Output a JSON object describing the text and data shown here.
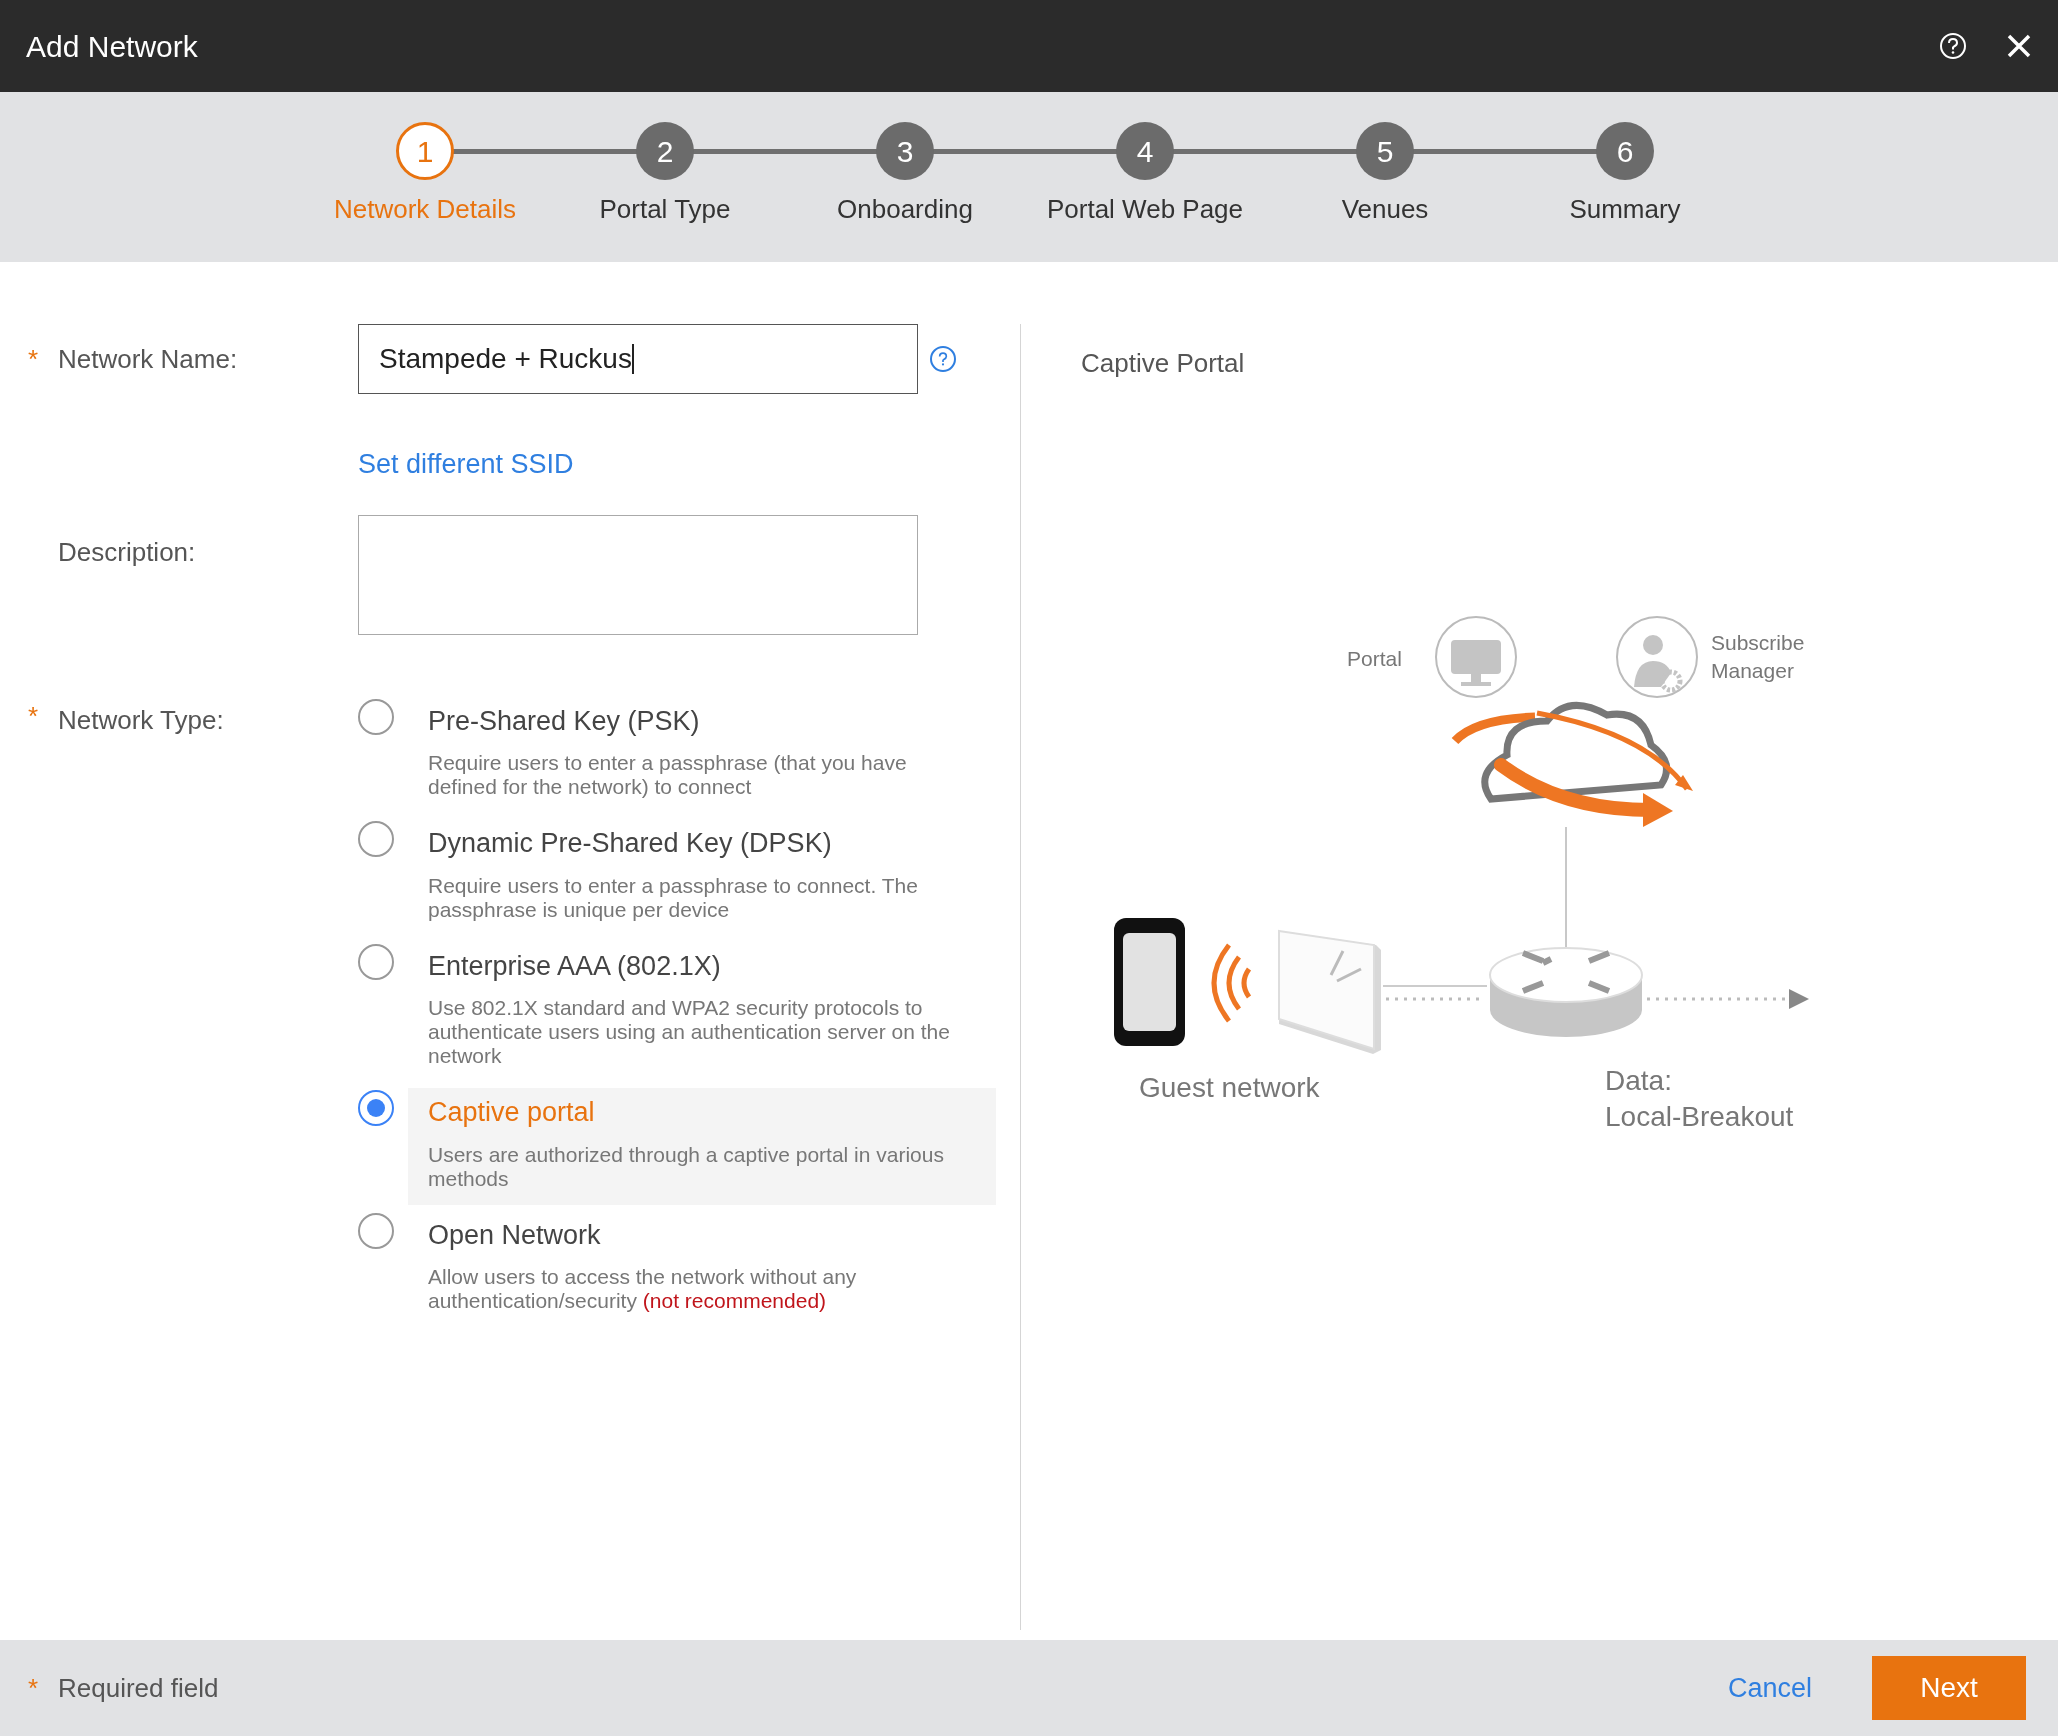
{
  "dialog": {
    "title": "Add Network"
  },
  "steps": [
    {
      "number": "1",
      "label": "Network Details",
      "selected": true
    },
    {
      "number": "2",
      "label": "Portal Type",
      "selected": false
    },
    {
      "number": "3",
      "label": "Onboarding",
      "selected": false
    },
    {
      "number": "4",
      "label": "Portal Web Page",
      "selected": false
    },
    {
      "number": "5",
      "label": "Venues",
      "selected": false
    },
    {
      "number": "6",
      "label": "Summary",
      "selected": false
    }
  ],
  "required_mark": "*",
  "form": {
    "network_name": {
      "label": "Network Name:",
      "required": true,
      "value": "Stampede + Ruckus"
    },
    "ssid_link": "Set different SSID",
    "description": {
      "label": "Description:",
      "required": false
    },
    "network_type": {
      "label": "Network Type:",
      "required": true,
      "options": [
        {
          "title": "Pre-Shared Key (PSK)",
          "description": "Require users to enter a passphrase (that you have defined for the network) to connect",
          "selected": false
        },
        {
          "title": "Dynamic Pre-Shared Key (DPSK)",
          "description": "Require users to enter a passphrase to connect. The passphrase is unique per device",
          "selected": false
        },
        {
          "title": "Enterprise AAA (802.1X)",
          "description": "Use 802.1X standard and WPA2 security protocols to authenticate users using an authentication server on the network",
          "selected": false
        },
        {
          "title": "Captive portal",
          "description": "Users are authorized through a captive portal in various methods",
          "selected": true
        },
        {
          "title": "Open Network",
          "description": "Allow users to access the network without any authentication/security",
          "warning": "(not recommended)",
          "selected": false
        }
      ]
    }
  },
  "preview": {
    "title": "Captive Portal",
    "portal_label": "Portal",
    "manager_label": [
      "Subscribe",
      "Manager"
    ],
    "guest_label": "Guest network",
    "data_label": [
      "Data:",
      "Local-Breakout"
    ]
  },
  "footer": {
    "required_note": "Required field",
    "cancel": "Cancel",
    "next": "Next"
  }
}
